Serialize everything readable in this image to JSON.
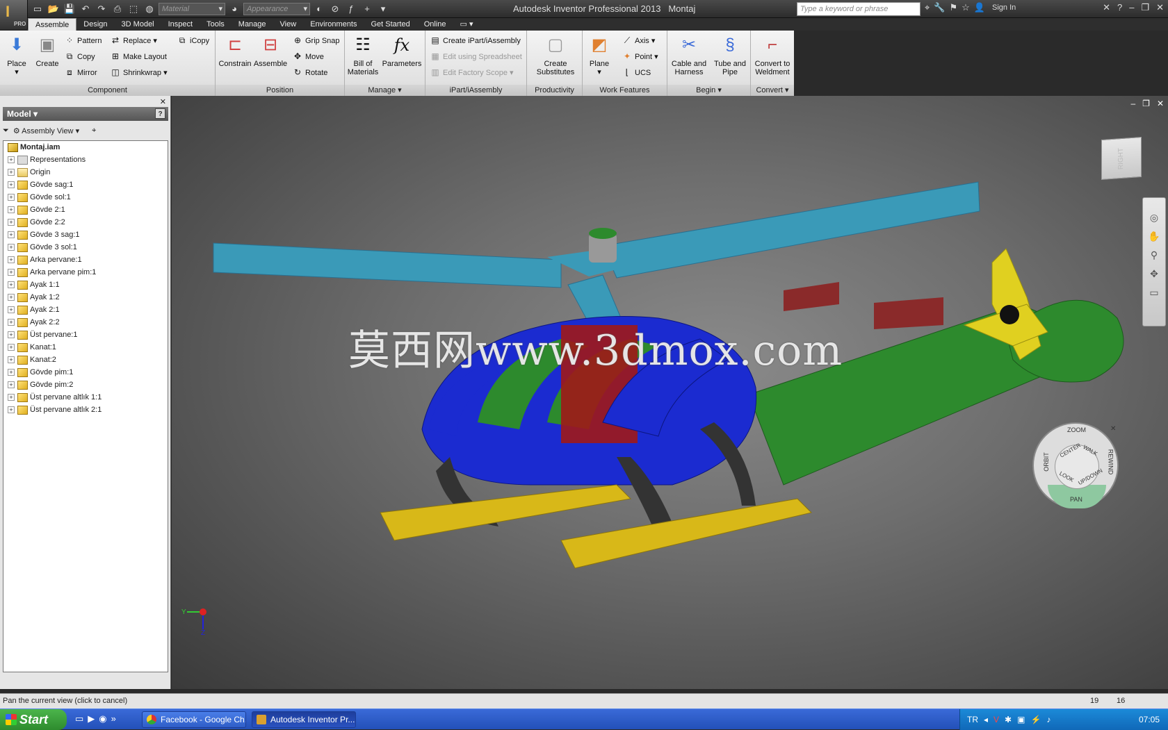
{
  "title_bar": {
    "app_title": "Autodesk Inventor Professional 2013",
    "doc_title": "Montaj",
    "material_placeholder": "Material",
    "appearance_placeholder": "Appearance",
    "search_placeholder": "Type a keyword or phrase",
    "sign_in": "Sign In",
    "app_button_badge": "PRO"
  },
  "tabs": [
    "Assemble",
    "Design",
    "3D Model",
    "Inspect",
    "Tools",
    "Manage",
    "View",
    "Environments",
    "Get Started",
    "Online"
  ],
  "ribbon": {
    "component": {
      "label": "Component",
      "place": "Place",
      "create": "Create",
      "pattern": "Pattern",
      "copy": "Copy",
      "mirror": "Mirror",
      "replace": "Replace",
      "make_layout": "Make Layout",
      "shrinkwrap": "Shrinkwrap",
      "icopy": "iCopy"
    },
    "position": {
      "label": "Position",
      "constrain": "Constrain",
      "assemble": "Assemble",
      "grip_snap": "Grip Snap",
      "move": "Move",
      "rotate": "Rotate"
    },
    "manage": {
      "label": "Manage",
      "bom": "Bill of\nMaterials",
      "parameters": "Parameters"
    },
    "ipart": {
      "label": "iPart/iAssembly",
      "create": "Create iPart/iAssembly",
      "edit_spreadsheet": "Edit using Spreadsheet",
      "edit_factory": "Edit Factory Scope"
    },
    "productivity": {
      "label": "Productivity",
      "create_substitutes": "Create\nSubstitutes"
    },
    "work_features": {
      "label": "Work Features",
      "plane": "Plane",
      "axis": "Axis",
      "point": "Point",
      "ucs": "UCS"
    },
    "begin": {
      "label": "Begin",
      "cable": "Cable and\nHarness",
      "tube": "Tube and\nPipe"
    },
    "convert": {
      "label": "Convert",
      "weldment": "Convert to\nWeldment"
    }
  },
  "browser": {
    "title": "Model",
    "view_mode": "Assembly View",
    "root": "Montaj.iam",
    "nodes": [
      "Representations",
      "Origin",
      "Gövde sag:1",
      "Gövde sol:1",
      "Gövde 2:1",
      "Gövde 2:2",
      "Gövde 3 sag:1",
      "Gövde 3 sol:1",
      "Arka pervane:1",
      "Arka pervane pim:1",
      "Ayak 1:1",
      "Ayak 1:2",
      "Ayak 2:1",
      "Ayak 2:2",
      "Üst pervane:1",
      "Kanat:1",
      "Kanat:2",
      "Gövde pim:1",
      "Gövde pim:2",
      "Üst pervane altlık 1:1",
      "Üst pervane altlık 2:1"
    ]
  },
  "viewport": {
    "viewcube_face": "RIGHT",
    "watermark": "莫西网www.3dmox.com",
    "wheel": {
      "zoom": "ZOOM",
      "orbit": "ORBIT",
      "rewind": "REWIND",
      "center": "CENTER",
      "walk": "WALK",
      "look": "LOOK",
      "updown": "UP/DOWN",
      "pan": "PAN"
    },
    "triad": {
      "x": "X",
      "y": "Y",
      "z": "Z"
    }
  },
  "status": {
    "message": "Pan the current view (click to cancel)",
    "n1": "19",
    "n2": "16"
  },
  "taskbar": {
    "start": "Start",
    "tasks": [
      "Facebook - Google Ch...",
      "Autodesk Inventor Pr..."
    ],
    "lang": "TR",
    "clock": "07:05"
  }
}
